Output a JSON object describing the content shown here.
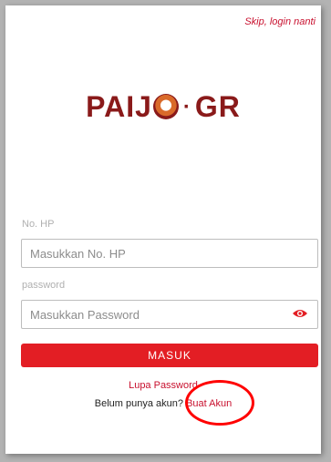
{
  "header": {
    "skip_label": "Skip, login nanti"
  },
  "logo": {
    "left_text": "PAIJ",
    "right_text": "GR",
    "separator": "·",
    "badge_icon": "paijo-badge-icon"
  },
  "form": {
    "phone_label": "No. HP",
    "phone_placeholder": "Masukkan No. HP",
    "password_label": "password",
    "password_placeholder": "Masukkan Password",
    "password_toggle_icon": "eye-icon",
    "submit_label": "MASUK",
    "forgot_label": "Lupa Password",
    "no_account_text": "Belum punya akun?",
    "signup_label": "Buat Akun"
  },
  "colors": {
    "accent": "#e31e24",
    "logo": "#8a1a1a",
    "highlight_circle": "#ff0000"
  }
}
